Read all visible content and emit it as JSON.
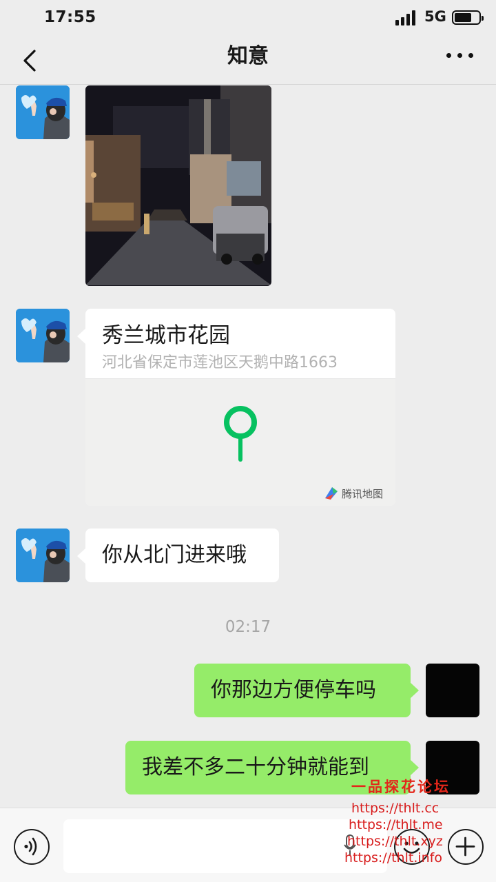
{
  "status_bar": {
    "time": "17:55",
    "network": "5G"
  },
  "nav": {
    "title": "知意"
  },
  "location": {
    "title": "秀兰城市花园",
    "address": "河北省保定市莲池区天鹅中路1663",
    "map_brand": "腾讯地图",
    "pin_color": "#07c160"
  },
  "messages": {
    "in_text": "你从北门进来哦",
    "timestamp": "02:17",
    "out_1": "你那边方便停车吗",
    "out_2": "我差不多二十分钟就能到"
  },
  "input": {
    "placeholder": ""
  },
  "watermark": {
    "title": "一品探花论坛",
    "links": [
      "https://thlt.cc",
      "https://thlt.me",
      "https://thlt.xyz",
      "https://thlt.info"
    ]
  },
  "colors": {
    "outgoing_bubble": "#95ec69",
    "background": "#ededed",
    "watermark": "#e4261a"
  }
}
